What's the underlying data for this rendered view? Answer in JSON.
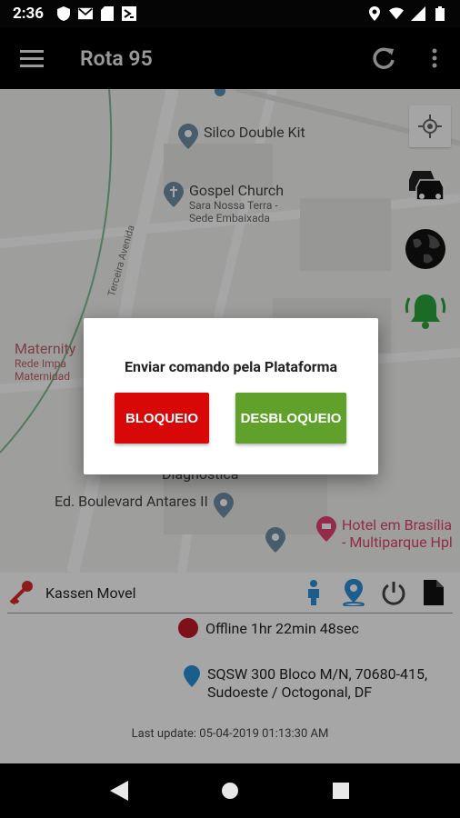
{
  "status_bar": {
    "time": "2:36"
  },
  "app_bar": {
    "title": "Rota 95",
    "icons": [
      "menu-icon",
      "refresh-icon",
      "more-vert-icon"
    ]
  },
  "map": {
    "pois": [
      {
        "name": "Silco Double Kit"
      },
      {
        "name": "Gospel Church",
        "sub": "Sara Nossa Terra -",
        "sub2": "Sede Embaixada"
      },
      {
        "name": "Maternity",
        "sub": "Rede Impa",
        "sub2": "Maternidad"
      },
      {
        "name": "Diagnóstica"
      },
      {
        "name": "Ed. Boulevard Antares II"
      },
      {
        "name": "Hotel em Brasília",
        "sub": "- Multiparque Hpl"
      }
    ],
    "street": "Terceira Avenida",
    "controls": [
      "my-location-icon",
      "traffic-cars-icon",
      "globe-icon",
      "alarm-bell-icon"
    ]
  },
  "dialog": {
    "title": "Enviar comando pela Plataforma",
    "block_label": "BLOQUEIO",
    "unblock_label": "DESBLOQUEIO",
    "block_color": "#d80808",
    "unblock_color": "#5fa12a"
  },
  "panel": {
    "vehicle_name": "Kassen Movel",
    "status": "Offline 1hr 22min 48sec",
    "address_line1": "SQSW 300 Bloco M/N, 70680-415,",
    "address_line2": "Sudoeste / Octogonal, DF",
    "last_update": "Last update: 05-04-2019 01:13:30 AM",
    "status_color": "#c21a2b"
  }
}
